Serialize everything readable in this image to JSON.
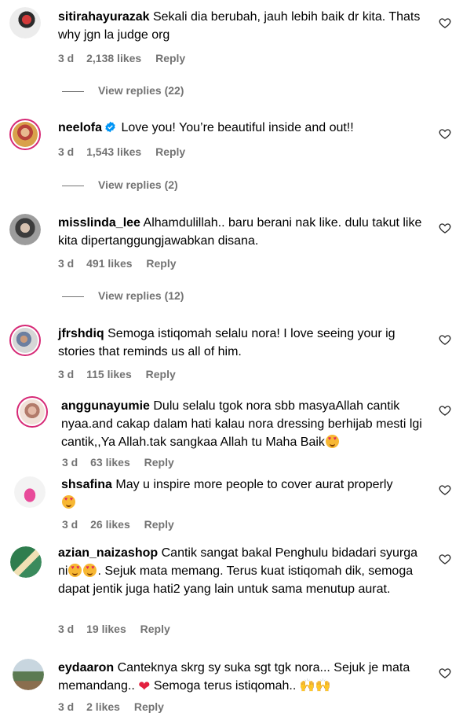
{
  "comments": [
    {
      "username": "sitirahayurazak",
      "text": "Sekali dia berubah, jauh lebih baik dr kita. Thats why jgn la judge org",
      "time": "3 d",
      "likes": "2,138 likes",
      "reply": "Reply",
      "view_replies": "View replies (22)"
    },
    {
      "username": "neelofa",
      "text": "Love you! You’re beautiful inside and out!!",
      "time": "3 d",
      "likes": "1,543 likes",
      "reply": "Reply",
      "view_replies": "View replies (2)"
    },
    {
      "username": "misslinda_lee",
      "text": "Alhamdulillah.. baru berani nak like. dulu takut like kita dipertanggungjawabkan disana.",
      "time": "3 d",
      "likes": "491 likes",
      "reply": "Reply",
      "view_replies": "View replies (12)"
    },
    {
      "username": "jfrshdiq",
      "text": "Semoga istiqomah selalu nora! I love seeing your ig stories that reminds us all of him.",
      "time": "3 d",
      "likes": "115 likes",
      "reply": "Reply"
    },
    {
      "username": "anggunayumie",
      "text": "Dulu selalu tgok nora sbb masyaAllah cantik nyaa.and cakap dalam hati kalau nora dressing berhijab mesti lgi cantik,,Ya Allah.tak sangkaa Allah tu Maha Baik",
      "time": "3 d",
      "likes": "63 likes",
      "reply": "Reply"
    },
    {
      "username": "shsafina",
      "text": "May u inspire more people to cover aurat properly",
      "time": "3 d",
      "likes": "26 likes",
      "reply": "Reply"
    },
    {
      "username": "azian_naizashop",
      "text_a": "Cantik sangat bakal Penghulu bidadari syurga ni",
      "text_b": ". Sejuk mata memang. Terus kuat istiqomah dik, semoga dapat jentik juga hati2 yang lain untuk sama menutup aurat.",
      "time": "3 d",
      "likes": "19 likes",
      "reply": "Reply"
    },
    {
      "username": "eydaaron",
      "text_a": "Canteknya skrg sy suka sgt tgk nora... Sejuk je mata memandang..",
      "text_b": "Semoga terus istiqomah..",
      "time": "3 d",
      "likes": "2 likes",
      "reply": "Reply"
    }
  ],
  "colors": {
    "text": "#000000",
    "meta": "#737373",
    "verified": "#0095f6",
    "story_ring": "#d62976"
  },
  "icons": {
    "like": "heart-outline-icon",
    "verified": "verified-badge-icon"
  }
}
